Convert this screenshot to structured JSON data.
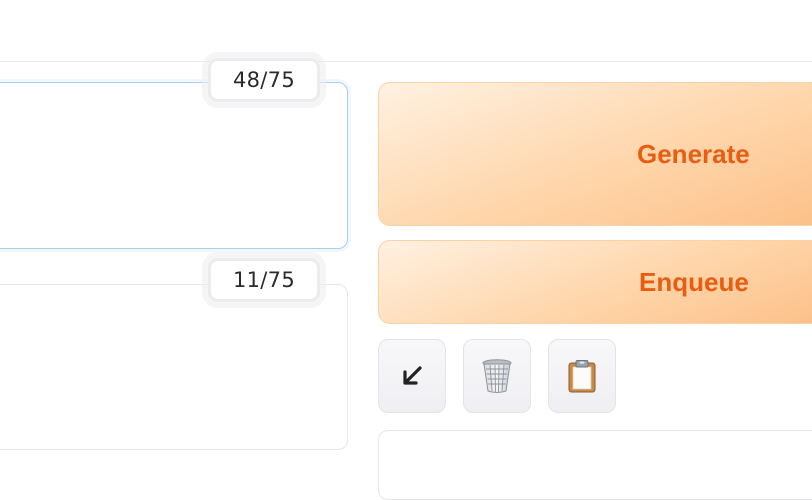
{
  "prompts": {
    "positive": {
      "value": "",
      "token_count": "48/75"
    },
    "negative": {
      "value": "",
      "token_count": "11/75"
    }
  },
  "actions": {
    "generate_label": "Generate",
    "enqueue_label": "Enqueue"
  },
  "tools": [
    {
      "icon": "arrow-down-left-icon"
    },
    {
      "icon": "trash-bin-icon"
    },
    {
      "icon": "clipboard-icon"
    }
  ],
  "colors": {
    "accent_text": "#e95d12",
    "button_gradient_start": "#fff1e2",
    "button_gradient_end": "#fcc089",
    "focus_border": "#a9cff2"
  }
}
